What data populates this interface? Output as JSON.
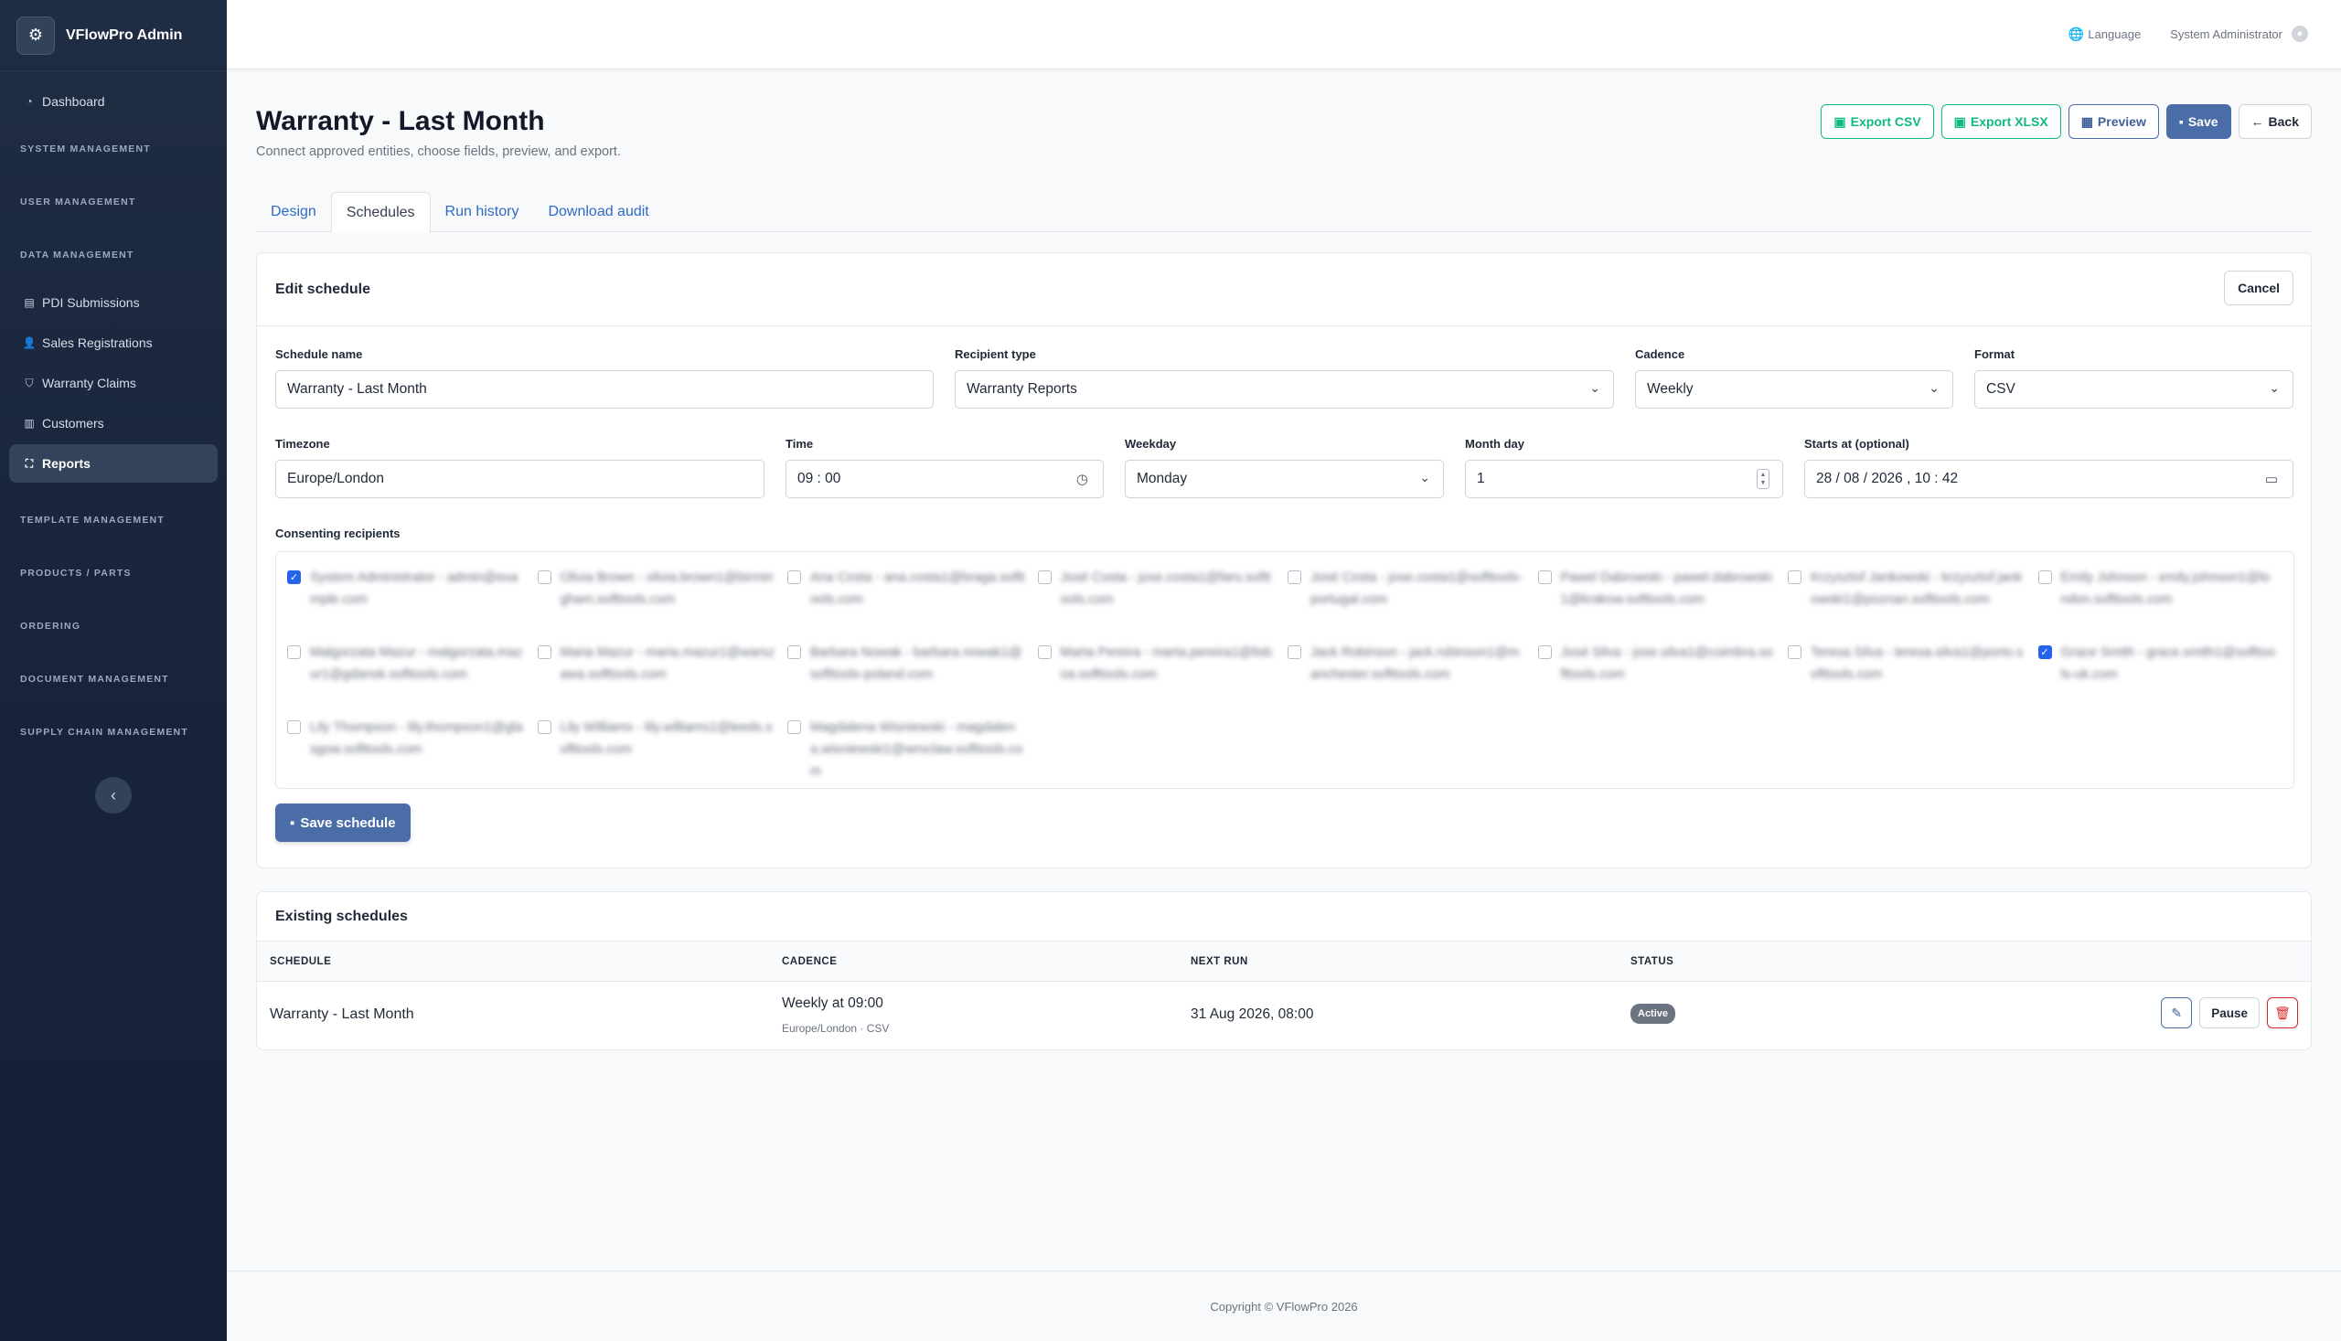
{
  "brand": {
    "title": "VFlowPro Admin",
    "logo_icon": "gears-icon"
  },
  "sidebar": {
    "dashboard": "Dashboard",
    "sections": {
      "system": "SYSTEM MANAGEMENT",
      "user": "USER MANAGEMENT",
      "data": "DATA MANAGEMENT",
      "template": "TEMPLATE MANAGEMENT",
      "products": "PRODUCTS / PARTS",
      "ordering": "ORDERING",
      "document": "DOCUMENT MANAGEMENT",
      "supply": "SUPPLY CHAIN MANAGEMENT"
    },
    "data_items": [
      "PDI Submissions",
      "Sales Registrations",
      "Warranty Claims",
      "Customers",
      "Reports"
    ],
    "active_item": "Reports"
  },
  "topbar": {
    "language": "Language",
    "user": "System Administrator"
  },
  "page": {
    "title": "Warranty - Last Month",
    "subtitle": "Connect approved entities, choose fields, preview, and export.",
    "actions": {
      "export_csv": "Export CSV",
      "export_xlsx": "Export XLSX",
      "preview": "Preview",
      "save": "Save",
      "back": "Back"
    },
    "tabs": [
      "Design",
      "Schedules",
      "Run history",
      "Download audit"
    ],
    "active_tab": "Schedules"
  },
  "edit_schedule": {
    "title": "Edit schedule",
    "cancel": "Cancel",
    "schedule_name": {
      "label": "Schedule name",
      "value": "Warranty - Last Month"
    },
    "recipient_type": {
      "label": "Recipient type",
      "value": "Warranty Reports"
    },
    "cadence": {
      "label": "Cadence",
      "value": "Weekly"
    },
    "format": {
      "label": "Format",
      "value": "CSV"
    },
    "timezone": {
      "label": "Timezone",
      "value": "Europe/London"
    },
    "time": {
      "label": "Time",
      "value": "09 : 00"
    },
    "weekday": {
      "label": "Weekday",
      "value": "Monday"
    },
    "month_day": {
      "label": "Month day",
      "value": "1"
    },
    "starts_at": {
      "label": "Starts at (optional)",
      "value": "28 / 08 / 2026 ,  10 : 42"
    },
    "recipients_label": "Consenting recipients",
    "recipients": [
      {
        "text": "System Administrator - admin@example.com",
        "checked": true
      },
      {
        "text": "Olivia Brown - olivia.brown1@birmingham.softtools.com",
        "checked": false
      },
      {
        "text": "Ana Costa - ana.costa1@braga.softtools.com",
        "checked": false
      },
      {
        "text": "José Costa - jose.costa1@faro.softtools.com",
        "checked": false
      },
      {
        "text": "José Costa - jose.costa1@softtools-portugal.com",
        "checked": false
      },
      {
        "text": "Pawel Dabrowski - pawel.dabrowski1@krakow.softtools.com",
        "checked": false
      },
      {
        "text": "Krzysztof Jankowski - krzysztof.jankowski1@poznan.softtools.com",
        "checked": false
      },
      {
        "text": "Emily Johnson - emily.johnson1@london.softtools.com",
        "checked": false
      },
      {
        "text": "Malgorzata Mazur - malgorzata.mazur1@gdansk.softtools.com",
        "checked": false
      },
      {
        "text": "Maria Mazur - maria.mazur1@warszawa.softtools.com",
        "checked": false
      },
      {
        "text": "Barbara Nowak - barbara.nowak1@softtools-poland.com",
        "checked": false
      },
      {
        "text": "Marta Pereira - marta.pereira1@lisboa.softtools.com",
        "checked": false
      },
      {
        "text": "Jack Robinson - jack.robinson1@manchester.softtools.com",
        "checked": false
      },
      {
        "text": "José Silva - jose.silva1@coimbra.softtools.com",
        "checked": false
      },
      {
        "text": "Teresa Silva - teresa.silva1@porto.softtools.com",
        "checked": false
      },
      {
        "text": "Grace Smith - grace.smith1@softtools-uk.com",
        "checked": true
      },
      {
        "text": "Lily Thompson - lily.thompson1@glasgow.softtools.com",
        "checked": false
      },
      {
        "text": "Lily Williams - lily.williams1@leeds.softtools.com",
        "checked": false
      },
      {
        "text": "Magdalena Wisniewski - magdalena.wisniewski1@wroclaw.softtools.com",
        "checked": false
      }
    ],
    "save_button": "Save schedule"
  },
  "existing": {
    "title": "Existing schedules",
    "columns": {
      "schedule": "SCHEDULE",
      "cadence": "CADENCE",
      "next_run": "NEXT RUN",
      "status": "STATUS"
    },
    "rows": [
      {
        "schedule": "Warranty - Last Month",
        "cadence": "Weekly at 09:00",
        "cadence_sub": "Europe/London · CSV",
        "next_run": "31 Aug 2026, 08:00",
        "status": "Active",
        "pause": "Pause"
      }
    ]
  },
  "footer": "Copyright © VFlowPro 2026",
  "colors": {
    "primary": "#4a6da7",
    "success": "#10b981",
    "danger": "#dc2626",
    "sidebar": "#1f2d44"
  }
}
